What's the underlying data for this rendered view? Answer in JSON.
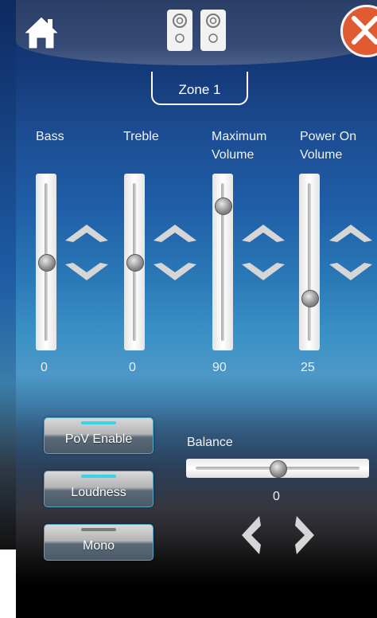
{
  "header": {
    "home_icon": "home-icon",
    "speakers_icon": "speakers-icon",
    "close_icon": "close-icon",
    "zone_label": "Zone 1"
  },
  "sliders": [
    {
      "label_line1": "Bass",
      "label_line2": "",
      "value_text": "0",
      "level": 0.5
    },
    {
      "label_line1": "Treble",
      "label_line2": "",
      "value_text": "0",
      "level": 0.5
    },
    {
      "label_line1": "Maximum",
      "label_line2": "Volume",
      "value_text": "90",
      "level": 0.9
    },
    {
      "label_line1": "Power On",
      "label_line2": "Volume",
      "value_text": "25",
      "level": 0.25
    }
  ],
  "buttons": [
    {
      "label": "PoV Enable",
      "indicator_color": "#38d4e6"
    },
    {
      "label": "Loudness",
      "indicator_color": "#38d4e6"
    },
    {
      "label": "Mono",
      "indicator_color": "#7b7b7b"
    }
  ],
  "balance": {
    "label": "Balance",
    "value_text": "0",
    "level": 0.5
  },
  "colors": {
    "accent": "#38d4e6",
    "close": "#e05a32"
  }
}
